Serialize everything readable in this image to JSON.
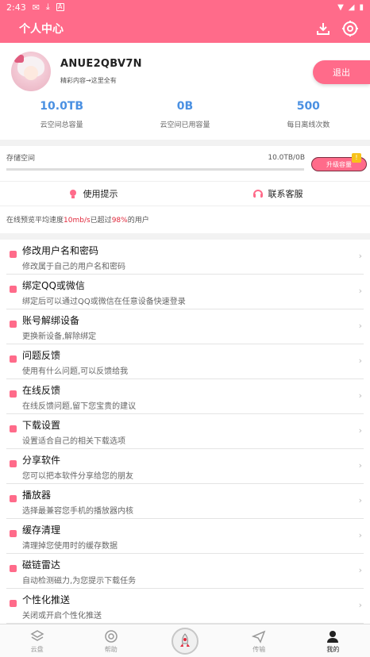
{
  "status_bar": {
    "time": "2:43"
  },
  "header": {
    "title": "个人中心"
  },
  "profile": {
    "username": "ANUE2QBV7N",
    "motto": "精彩内容→这里全有",
    "logout_label": "退出"
  },
  "stats": [
    {
      "value": "10.0TB",
      "label": "云空间总容量"
    },
    {
      "value": "0B",
      "label": "云空间已用容量"
    },
    {
      "value": "500",
      "label": "每日离线次数"
    }
  ],
  "storage": {
    "label": "存储空间",
    "amount": "10.0TB/0B",
    "used_fraction": 0.0,
    "upgrade_label": "升级容量",
    "upgrade_badge": "!"
  },
  "tips": {
    "usage": "使用提示",
    "contact": "联系客服"
  },
  "speed": {
    "prefix": "在线预览平均速度",
    "rate": "10mb/s",
    "middle": "已超过",
    "percent": "98%",
    "suffix": "的用户"
  },
  "menu": [
    {
      "title": "修改用户名和密码",
      "sub": "修改属于自己的用户名和密码"
    },
    {
      "title": "绑定QQ或微信",
      "sub": "绑定后可以通过QQ或微信在任意设备快速登录"
    },
    {
      "title": "账号解绑设备",
      "sub": "更换新设备,解除绑定"
    },
    {
      "title": "问题反馈",
      "sub": "使用有什么问题,可以反馈给我"
    },
    {
      "title": "在线反馈",
      "sub": "在线反馈问题,留下您宝贵的建议"
    },
    {
      "title": "下载设置",
      "sub": "设置适合自己的相关下载选项"
    },
    {
      "title": "分享软件",
      "sub": "您可以把本软件分享给您的朋友"
    },
    {
      "title": "播放器",
      "sub": "选择最兼容您手机的播放器内核"
    },
    {
      "title": "缓存清理",
      "sub": "清理掉您使用时的缓存数据"
    },
    {
      "title": "磁链雷达",
      "sub": "自动检测磁力,为您提示下载任务"
    },
    {
      "title": "个性化推送",
      "sub": "关闭或开启个性化推送"
    }
  ],
  "tabbar": {
    "cloud": "云盘",
    "help": "帮助",
    "transfer": "传输",
    "mine": "我的"
  },
  "colors": {
    "accent": "#ff6b8a",
    "stat_value": "#4a90e2",
    "highlight": "#e0283b"
  }
}
